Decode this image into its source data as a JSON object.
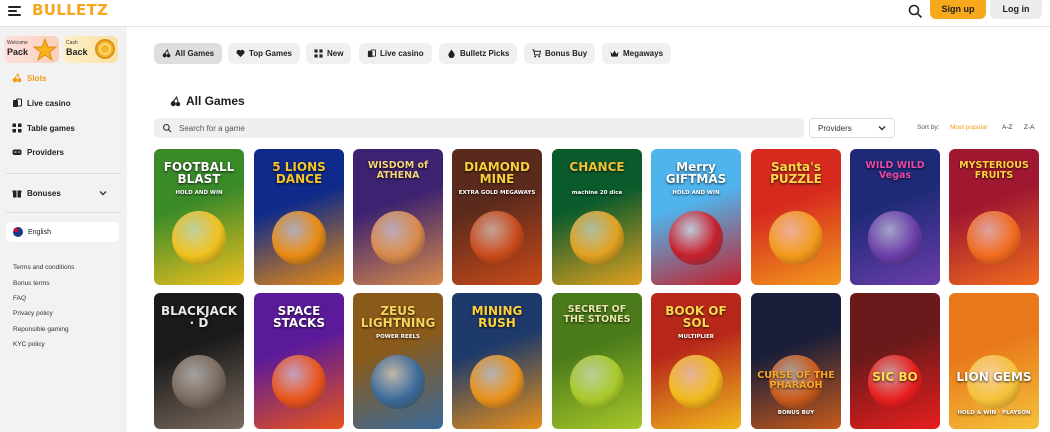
{
  "header": {
    "logo": "BULLETZ",
    "signup_label": "Sign up",
    "login_label": "Log in"
  },
  "sidebar": {
    "promos": [
      {
        "small": "Welcome",
        "big": "Pack",
        "icon": "star-icon"
      },
      {
        "small": "Cash",
        "big": "Back",
        "icon": "coin-icon"
      }
    ],
    "nav": [
      {
        "label": "Slots",
        "icon": "cherry-icon",
        "active": true
      },
      {
        "label": "Live casino",
        "icon": "cards-icon"
      },
      {
        "label": "Table games",
        "icon": "grid-icon"
      },
      {
        "label": "Providers",
        "icon": "gamepad-icon"
      }
    ],
    "bonuses_label": "Bonuses",
    "language": "English",
    "footer_links": [
      "Terms and conditions",
      "Bonus terms",
      "FAQ",
      "Privacy policy",
      "Reponsible gaming",
      "KYC policy"
    ]
  },
  "tabs": [
    {
      "label": "All Games",
      "icon": "cherry-icon",
      "active": true
    },
    {
      "label": "Top Games",
      "icon": "heart-icon"
    },
    {
      "label": "New",
      "icon": "grid-icon"
    },
    {
      "label": "Live casino",
      "icon": "cards-icon"
    },
    {
      "label": "Bulletz Picks",
      "icon": "drop-icon"
    },
    {
      "label": "Bonus Buy",
      "icon": "cart-icon"
    },
    {
      "label": "Megaways",
      "icon": "crown-icon"
    }
  ],
  "section": {
    "title": "All Games",
    "search_placeholder": "Search for a game",
    "providers_label": "Providers",
    "sort_label": "Sort by:",
    "sort_options": [
      "Most popular",
      "A-Z",
      "Z-A"
    ]
  },
  "games": [
    {
      "title": "FOOTBALL BLAST",
      "sub": "HOLD AND WIN",
      "bg": "#3a8a2a",
      "bg2": "#f0c01e",
      "fg": "#ffffff"
    },
    {
      "title": "5 LIONS DANCE",
      "sub": "",
      "bg": "#0e2a8a",
      "bg2": "#e88a12",
      "fg": "#f7c52c"
    },
    {
      "title": "WISDOM of ATHENA",
      "sub": "",
      "bg": "#3c2270",
      "bg2": "#d88a4a",
      "fg": "#f5d57a"
    },
    {
      "title": "DIAMOND MINE",
      "sub": "EXTRA GOLD MEGAWAYS",
      "bg": "#5a2a1c",
      "bg2": "#c84a1a",
      "fg": "#f5d03a"
    },
    {
      "title": "CHANCE",
      "sub": "machine 20 dice",
      "bg": "#0b5a2c",
      "bg2": "#e0a020",
      "fg": "#f2c232"
    },
    {
      "title": "Merry GIFTMAS",
      "sub": "HOLD AND WIN",
      "bg": "#4fb4ec",
      "bg2": "#c51f2a",
      "fg": "#ffffff"
    },
    {
      "title": "Santa's PUZZLE",
      "sub": "",
      "bg": "#d62a1e",
      "bg2": "#f29a1c",
      "fg": "#ffd84a"
    },
    {
      "title": "WILD WILD Vegas",
      "sub": "",
      "bg": "#1e2a78",
      "bg2": "#6a3da8",
      "fg": "#e84aa8"
    },
    {
      "title": "MYSTERIOUS FRUITS",
      "sub": "",
      "bg": "#a01830",
      "bg2": "#f06a1e",
      "fg": "#ffd13a"
    },
    {
      "title": "BLACKJACK · D",
      "sub": "",
      "bg": "#1a1a1a",
      "bg2": "#7a6a5e",
      "fg": "#e8e8e8"
    },
    {
      "title": "SPACE STACKS",
      "sub": "",
      "bg": "#5a1a9a",
      "bg2": "#e8541a",
      "fg": "#ffffff"
    },
    {
      "title": "ZEUS LIGHTNING",
      "sub": "POWER REELS",
      "bg": "#8a5a1a",
      "bg2": "#3a6a9a",
      "fg": "#f7d45a"
    },
    {
      "title": "MINING RUSH",
      "sub": "",
      "bg": "#1e3a6a",
      "bg2": "#e8901a",
      "fg": "#ffd23a"
    },
    {
      "title": "SECRET OF THE STONES",
      "sub": "",
      "bg": "#4a7a1a",
      "bg2": "#a8c82a",
      "fg": "#e8e8a8"
    },
    {
      "title": "BOOK OF SOL",
      "sub": "MULTIPLIER",
      "bg": "#b8281a",
      "bg2": "#f0b81c",
      "fg": "#ffd84a"
    },
    {
      "title": "CURSE OF THE PHARAOH",
      "sub": "BONUS BUY",
      "bg": "#1a1e3a",
      "bg2": "#c85a1a",
      "fg": "#f7a82a"
    },
    {
      "title": "SIC BO",
      "sub": "",
      "bg": "#6a1a1a",
      "bg2": "#e81e1e",
      "fg": "#ffe04a"
    },
    {
      "title": "LION GEMS",
      "sub": "HOLD & WIN · PLAYSON",
      "bg": "#e8781a",
      "bg2": "#f5c23a",
      "fg": "#ffffff"
    }
  ]
}
